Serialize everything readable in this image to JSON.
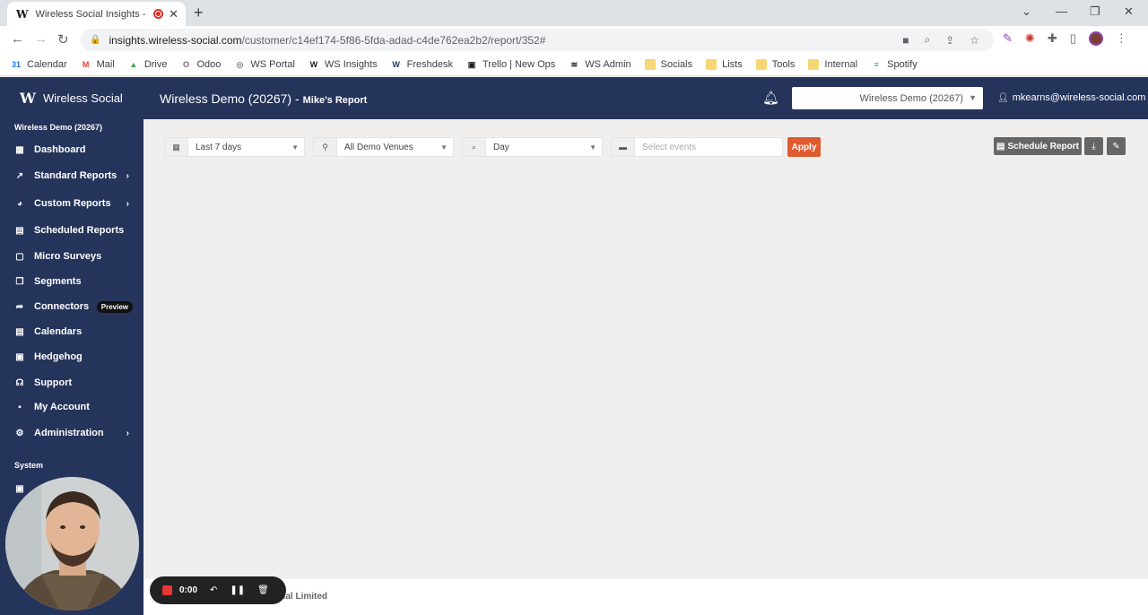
{
  "browser": {
    "tab_title": "Wireless Social Insights - Wi",
    "tab_favicon": "W",
    "url_host": "insights.wireless-social.com",
    "url_path": "/customer/c14ef174-5f86-5fda-adad-c4de762ea2b2/report/352#"
  },
  "bookmarks": [
    {
      "label": "Calendar",
      "icon": "calendar-icon",
      "color": "#1a73e8",
      "glyph": "31"
    },
    {
      "label": "Mail",
      "icon": "gmail-icon",
      "color": "#ea4335",
      "glyph": "M"
    },
    {
      "label": "Drive",
      "icon": "drive-icon",
      "color": "#34a853",
      "glyph": "▲"
    },
    {
      "label": "Odoo",
      "icon": "odoo-icon",
      "color": "#875a7b",
      "glyph": "O"
    },
    {
      "label": "WS Portal",
      "icon": "globe-icon",
      "color": "#888888",
      "glyph": "◎"
    },
    {
      "label": "WS Insights",
      "icon": "ws-logo-icon",
      "color": "#1b1b1b",
      "glyph": "W"
    },
    {
      "label": "Freshdesk",
      "icon": "freshdesk-icon",
      "color": "#24345a",
      "glyph": "W"
    },
    {
      "label": "Trello | New Ops",
      "icon": "trello-icon",
      "color": "#1b1b1b",
      "glyph": "▣"
    },
    {
      "label": "WS Admin",
      "icon": "wifi-icon",
      "color": "#1b1b1b",
      "glyph": "≋"
    },
    {
      "label": "Socials",
      "icon": "folder-icon",
      "color": "#f7d774",
      "glyph": ""
    },
    {
      "label": "Lists",
      "icon": "folder-icon",
      "color": "#f7d774",
      "glyph": ""
    },
    {
      "label": "Tools",
      "icon": "folder-icon",
      "color": "#f7d774",
      "glyph": ""
    },
    {
      "label": "Internal",
      "icon": "folder-icon",
      "color": "#f7d774",
      "glyph": ""
    },
    {
      "label": "Spotify",
      "icon": "spotify-icon",
      "color": "#1db954",
      "glyph": "≡"
    }
  ],
  "header": {
    "brand": "Wireless Social",
    "title": "Wireless Demo (20267) -",
    "subtitle": "Mike's Report",
    "venue_selected": "Wireless Demo (20267)",
    "user_email": "mkearns@wireless-social.com"
  },
  "sidebar": {
    "org_name": "Wireless Demo (20267)",
    "items": [
      {
        "label": "Dashboard",
        "icon": "dashboard-icon",
        "glyph": "▦"
      },
      {
        "label": "Standard Reports",
        "icon": "chart-line-icon",
        "glyph": "↗",
        "chevron": true
      },
      {
        "label": "Custom Reports",
        "icon": "pie-chart-icon",
        "glyph": "◕",
        "chevron": true
      },
      {
        "label": "Scheduled Reports",
        "icon": "calendar-clock-icon",
        "glyph": "▤"
      },
      {
        "label": "Micro Surveys",
        "icon": "survey-icon",
        "glyph": "▢"
      },
      {
        "label": "Segments",
        "icon": "segments-icon",
        "glyph": "❐"
      },
      {
        "label": "Connectors",
        "icon": "share-arrow-icon",
        "glyph": "➦",
        "badge": "Preview"
      },
      {
        "label": "Calendars",
        "icon": "calendar-icon",
        "glyph": "▤"
      },
      {
        "label": "Hedgehog",
        "icon": "id-card-icon",
        "glyph": "▣"
      },
      {
        "label": "Support",
        "icon": "headset-icon",
        "glyph": "☊"
      },
      {
        "label": "My Account",
        "icon": "user-card-icon",
        "glyph": "▪"
      },
      {
        "label": "Administration",
        "icon": "cog-icon",
        "glyph": "⚙",
        "chevron": true
      }
    ],
    "system_label": "System"
  },
  "filters": {
    "date_range": "Last 7 days",
    "venues": "All Demo Venues",
    "granularity": "Day",
    "events_placeholder": "Select events",
    "apply_label": "Apply",
    "schedule_label": "Schedule Report"
  },
  "footer": {
    "text": "cial Limited"
  },
  "recorder": {
    "time": "0:00"
  }
}
